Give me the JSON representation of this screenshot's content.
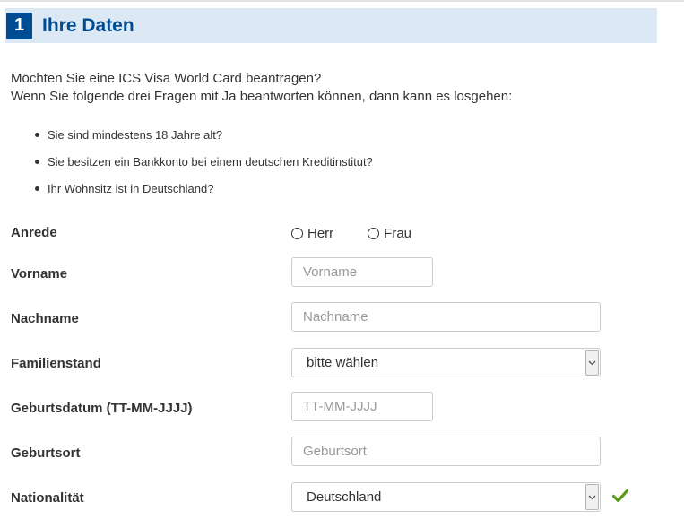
{
  "section": {
    "number": "1",
    "title": "Ihre Daten"
  },
  "intro": {
    "line1": "Möchten Sie eine ICS Visa World Card beantragen?",
    "line2": "Wenn Sie folgende drei Fragen mit Ja beantworten können, dann kann es losgehen:"
  },
  "questions": [
    "Sie sind mindestens 18 Jahre alt?",
    "Sie besitzen ein Bankkonto bei einem deutschen Kreditinstitut?",
    "Ihr Wohnsitz ist in Deutschland?"
  ],
  "form": {
    "anrede": {
      "label": "Anrede",
      "options": [
        "Herr",
        "Frau"
      ]
    },
    "vorname": {
      "label": "Vorname",
      "placeholder": "Vorname",
      "value": ""
    },
    "nachname": {
      "label": "Nachname",
      "placeholder": "Nachname",
      "value": ""
    },
    "familienstand": {
      "label": "Familienstand",
      "selected": "bitte wählen"
    },
    "geburtsdatum": {
      "label": "Geburtsdatum (TT-MM-JJJJ)",
      "placeholder": "TT-MM-JJJJ",
      "value": ""
    },
    "geburtsort": {
      "label": "Geburtsort",
      "placeholder": "Geburtsort",
      "value": ""
    },
    "nationalitaet": {
      "label": "Nationalität",
      "selected": "Deutschland",
      "valid": true
    }
  },
  "colors": {
    "brand": "#004c93",
    "header_bg": "#dce9f5",
    "valid_check": "#5a9a1a"
  },
  "icons": {
    "select_arrow": "chevron-down-icon",
    "valid": "checkmark-icon",
    "bullet": "bullet-dot-icon"
  }
}
